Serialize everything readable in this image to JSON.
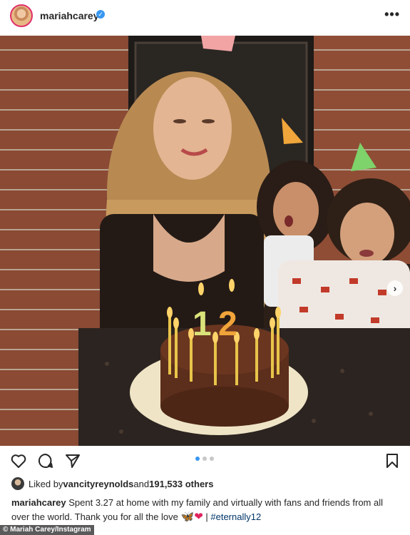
{
  "post": {
    "username": "mariahcarey",
    "verified_mark": "✓",
    "more_label": "•••",
    "photo_alt": "",
    "carousel_next": "›"
  },
  "likes": {
    "prefix": "Liked by ",
    "user": "vancityreynolds",
    "middle": " and ",
    "count": "191,533 others"
  },
  "caption": {
    "username": "mariahcarey",
    "text": " Spent 3.27 at home with my family and virtually with fans and friends from all over the world. Thank you for all the love ",
    "butterfly": "🦋",
    "heart": "❤",
    "separator": " | ",
    "hashtag": "#eternally12"
  },
  "credit": "© Mariah Carey/Instagram",
  "candles": {
    "number_one": "1",
    "number_two": "2"
  },
  "icons": {
    "like": "heart-icon",
    "comment": "comment-icon",
    "share": "send-icon",
    "save": "bookmark-icon"
  },
  "colors": {
    "verified": "#3897f0",
    "active_dot": "#3897f0",
    "hashtag": "#003569"
  },
  "carousel": {
    "total": 3,
    "active": 1
  }
}
